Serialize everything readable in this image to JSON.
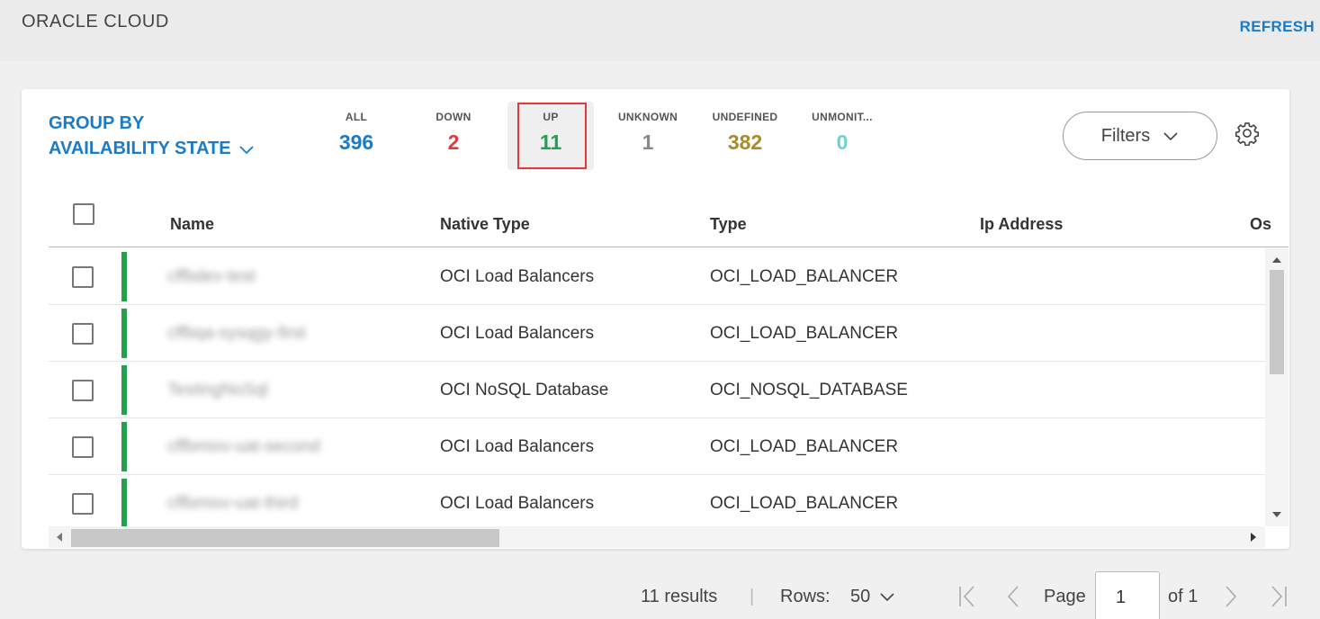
{
  "header": {
    "title": "ORACLE CLOUD",
    "refresh": "REFRESH"
  },
  "group_by": {
    "line1": "GROUP BY",
    "line2": "AVAILABILITY STATE"
  },
  "stats": [
    {
      "label": "ALL",
      "value": "396",
      "color": "#1a7bc8"
    },
    {
      "label": "DOWN",
      "value": "2",
      "color": "#e0393e"
    },
    {
      "label": "UP",
      "value": "11",
      "color": "#22a04b"
    },
    {
      "label": "UNKNOWN",
      "value": "1",
      "color": "#888888"
    },
    {
      "label": "UNDEFINED",
      "value": "382",
      "color": "#a88b2c"
    },
    {
      "label": "UNMONIT...",
      "value": "0",
      "color": "#6dd0d8"
    }
  ],
  "selected_stat": "UP",
  "filters": {
    "label": "Filters"
  },
  "table": {
    "columns": [
      "Name",
      "Native Type",
      "Type",
      "Ip Address",
      "Os"
    ],
    "rows": [
      {
        "name": "cffbdev-test",
        "native_type": "OCI Load Balancers",
        "type": "OCI_LOAD_BALANCER",
        "status_color": "#22a04b"
      },
      {
        "name": "cffbqa-sysqgy-first",
        "native_type": "OCI Load Balancers",
        "type": "OCI_LOAD_BALANCER",
        "status_color": "#22a04b"
      },
      {
        "name": "TestingNoSql",
        "native_type": "OCI NoSQL Database",
        "type": "OCI_NOSQL_DATABASE",
        "status_color": "#22a04b"
      },
      {
        "name": "cffbmixv-uat-second",
        "native_type": "OCI Load Balancers",
        "type": "OCI_LOAD_BALANCER",
        "status_color": "#22a04b"
      },
      {
        "name": "cffbmixv-uat-third",
        "native_type": "OCI Load Balancers",
        "type": "OCI_LOAD_BALANCER",
        "status_color": "#22a04b"
      }
    ]
  },
  "footer": {
    "results": "11 results",
    "separator": "|",
    "rows_label": "Rows:",
    "rows_value": "50",
    "page_label": "Page",
    "page_value": "1",
    "of_label": "of 1"
  }
}
